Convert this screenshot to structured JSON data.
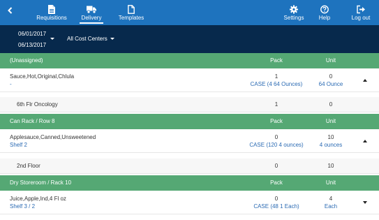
{
  "nav": {
    "items": [
      {
        "label": "Requisitions",
        "icon": "document-icon"
      },
      {
        "label": "Delivery",
        "icon": "truck-icon",
        "active": true
      },
      {
        "label": "Templates",
        "icon": "blank-document-icon"
      },
      {
        "label": "Settings",
        "icon": "gear-icon"
      },
      {
        "label": "Help",
        "icon": "question-circle-icon"
      },
      {
        "label": "Log out",
        "icon": "logout-icon"
      }
    ]
  },
  "filters": {
    "date_from": "06/01/2017",
    "date_to": "06/13/2017",
    "cost_center": "All Cost Centers"
  },
  "colors": {
    "nav_bg": "#1e73be",
    "filter_bg": "#07294c",
    "group_bg": "#55a874",
    "link_text": "#2a6ab3"
  },
  "groups": [
    {
      "name": "(Unassigned)",
      "pack_header": "Pack",
      "unit_header": "Unit",
      "item": {
        "name": "Sauce,Hot,Original,Chlula",
        "location": "-",
        "pack": "1",
        "pack_desc": "CASE (4 64 Ounces)",
        "unit": "0",
        "unit_desc": "64 Ounce",
        "expanded": true
      },
      "sub": {
        "name": "6th Flr Oncology",
        "pack": "1",
        "unit": "0"
      }
    },
    {
      "name": "Can Rack / Row 8",
      "pack_header": "Pack",
      "unit_header": "Unit",
      "item": {
        "name": "Applesauce,Canned,Unsweetened",
        "location": "Shelf 2",
        "pack": "0",
        "pack_desc": "CASE (120 4 ounces)",
        "unit": "10",
        "unit_desc": "4 ounces",
        "expanded": true
      },
      "sub": {
        "name": "2nd Floor",
        "pack": "0",
        "unit": "10"
      }
    },
    {
      "name": "Dry Storeroom / Rack 10",
      "pack_header": "Pack",
      "unit_header": "Unit",
      "item": {
        "name": "Juice,Apple,Ind,4 Fl oz",
        "location": "Shelf 3 / 2",
        "pack": "0",
        "pack_desc": "CASE (48 1 Each)",
        "unit": "4",
        "unit_desc": "Each",
        "expanded": false
      }
    }
  ]
}
